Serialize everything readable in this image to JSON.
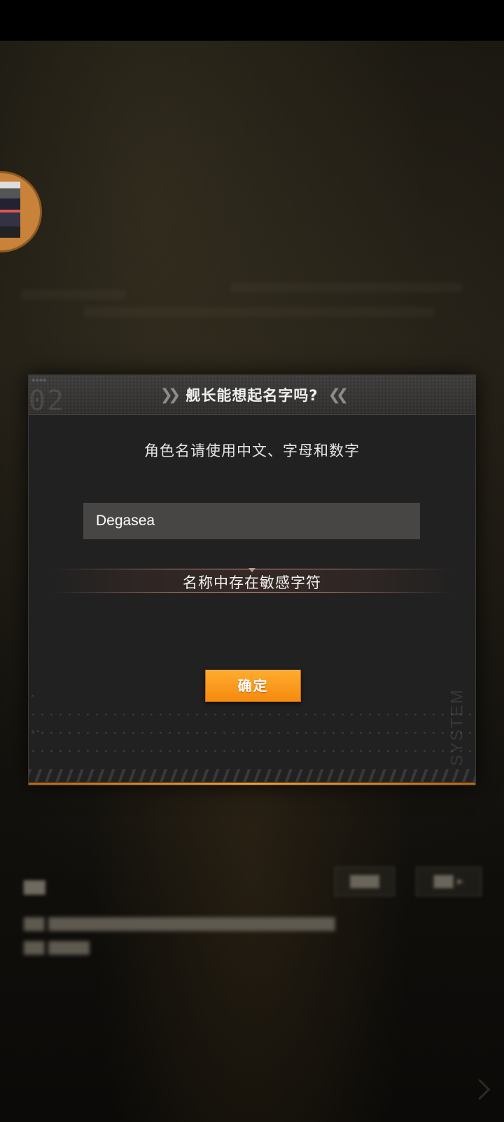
{
  "modal": {
    "title": "舰长能想起名字吗?",
    "header_deco_number": "02",
    "instruction": "角色名请使用中文、字母和数字",
    "name_input_value": "Degasea",
    "error_message": "名称中存在敏感字符",
    "confirm_label": "确定",
    "watermark": "SYSTEM"
  },
  "colors": {
    "accent_orange": "#f58a0f",
    "panel_bg": "#222121",
    "input_bg": "#474645"
  }
}
